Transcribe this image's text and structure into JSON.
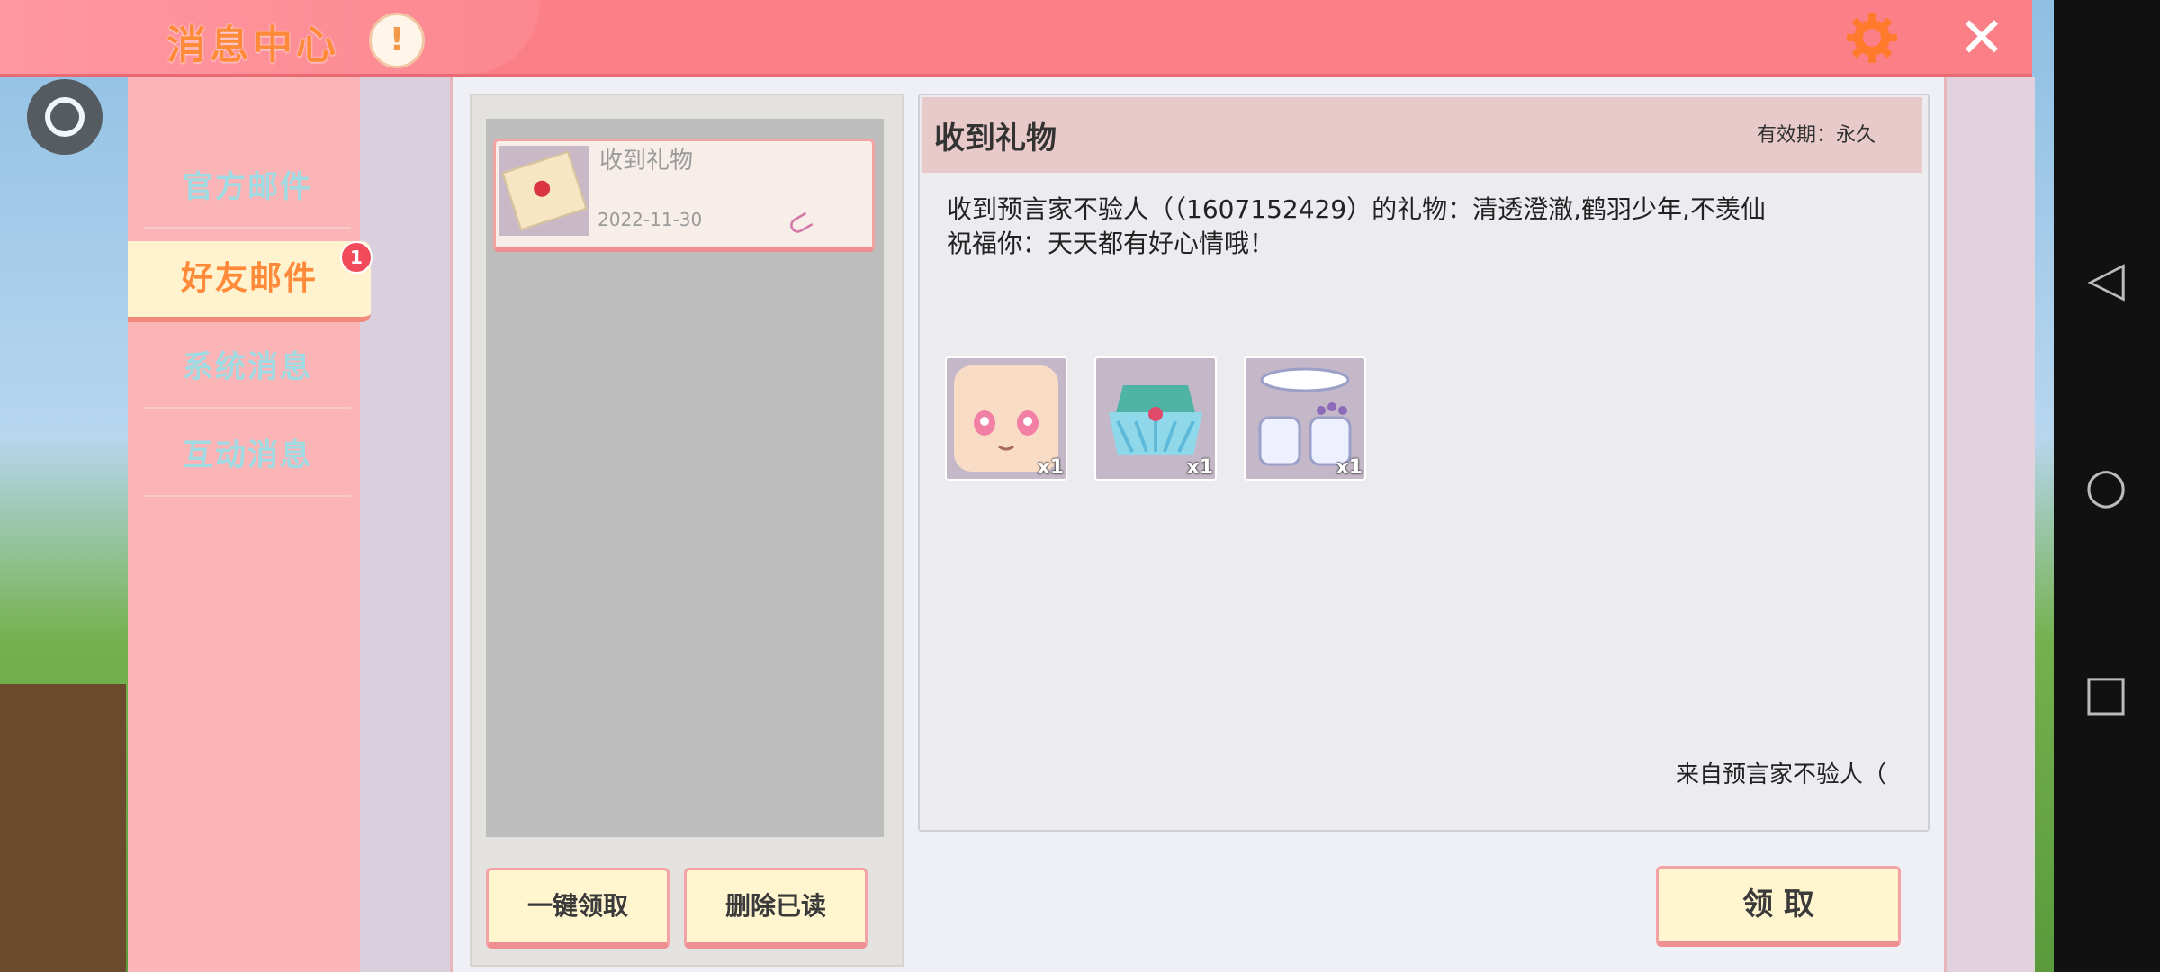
{
  "title": "消息中心",
  "info_glyph": "!",
  "close_glyph": "✕",
  "tabs": [
    {
      "label": "官方邮件",
      "active": false
    },
    {
      "label": "好友邮件",
      "active": true,
      "badge": "1"
    },
    {
      "label": "系统消息",
      "active": false
    },
    {
      "label": "互动消息",
      "active": false
    }
  ],
  "mail_list": [
    {
      "title": "收到礼物",
      "date": "2022-11-30",
      "icon": "envelope-icon",
      "attachment_icon": "paperclip-icon"
    }
  ],
  "list_buttons": {
    "claim_all": "一键领取",
    "delete_read": "删除已读"
  },
  "detail": {
    "title": "收到礼物",
    "validity": "有效期：永久",
    "body": "收到预言家不验人（（1607152429）的礼物：清透澄澈,鹤羽少年,不羡仙\n祝福你：天天都有好心情哦！",
    "items": [
      {
        "icon": "face-icon",
        "count": "x1"
      },
      {
        "icon": "feather-shawl-icon",
        "count": "x1"
      },
      {
        "icon": "collar-cuffs-icon",
        "count": "x1"
      }
    ],
    "from": "来自预言家不验人（",
    "claim": "领 取"
  },
  "colors": {
    "accent": "#fb7f86",
    "title_orange": "#ff8a3a",
    "tab_inactive": "#9fd9e2",
    "button_bg": "#fff5cf"
  }
}
